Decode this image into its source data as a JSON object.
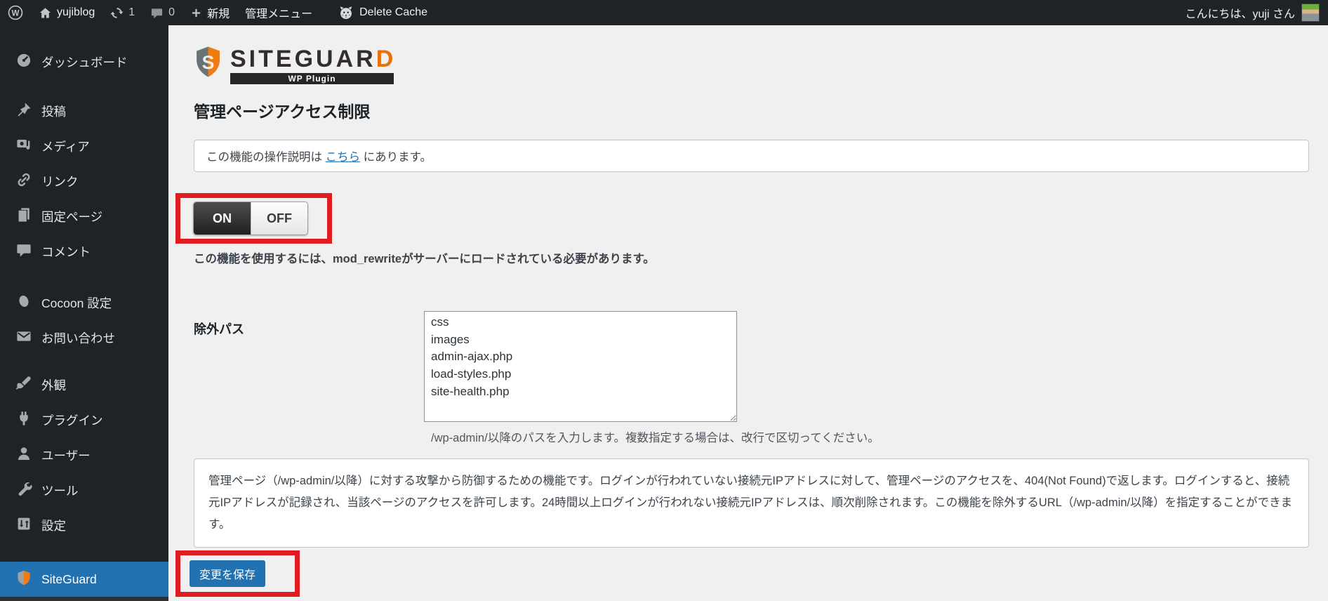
{
  "admin_bar": {
    "site_name": "yujiblog",
    "update_count": "1",
    "comment_count": "0",
    "new_label": "新規",
    "admin_menu_label": "管理メニュー",
    "delete_cache_label": "Delete Cache",
    "greeting": "こんにちは、yuji さん"
  },
  "sidebar": {
    "items": [
      {
        "label": "ダッシュボード"
      },
      {
        "label": "投稿"
      },
      {
        "label": "メディア"
      },
      {
        "label": "リンク"
      },
      {
        "label": "固定ページ"
      },
      {
        "label": "コメント"
      },
      {
        "label": "Cocoon 設定"
      },
      {
        "label": "お問い合わせ"
      },
      {
        "label": "外観"
      },
      {
        "label": "プラグイン"
      },
      {
        "label": "ユーザー"
      },
      {
        "label": "ツール"
      },
      {
        "label": "設定"
      },
      {
        "label": "SiteGuard"
      }
    ]
  },
  "logo": {
    "brand_main": "SITEGUAR",
    "brand_accent": "D",
    "subtitle": "WP Plugin"
  },
  "page": {
    "title": "管理ページアクセス制限",
    "notice_prefix": "この機能の操作説明は ",
    "notice_link": "こちら",
    "notice_suffix": " にあります。",
    "toggle_on": "ON",
    "toggle_off": "OFF",
    "mod_rewrite_note": "この機能を使用するには、mod_rewriteがサーバーにロードされている必要があります。",
    "exclude_label": "除外パス",
    "exclude_paths": "css\nimages\nadmin-ajax.php\nload-styles.php\nsite-health.php",
    "exclude_help": "/wp-admin/以降のパスを入力します。複数指定する場合は、改行で区切ってください。",
    "description": "管理ページ（/wp-admin/以降）に対する攻撃から防御するための機能です。ログインが行われていない接続元IPアドレスに対して、管理ページのアクセスを、404(Not Found)で返します。ログインすると、接続元IPアドレスが記録され、当該ページのアクセスを許可します。24時間以上ログインが行われない接続元IPアドレスは、順次削除されます。この機能を除外するURL（/wp-admin/以降）を指定することができます。",
    "save_button": "変更を保存"
  },
  "colors": {
    "accent_blue": "#2271b1",
    "annotation_red": "#e01b22",
    "sidebar_bg": "#1d2327",
    "content_bg": "#f0f0f1",
    "brand_orange": "#e8710a"
  }
}
